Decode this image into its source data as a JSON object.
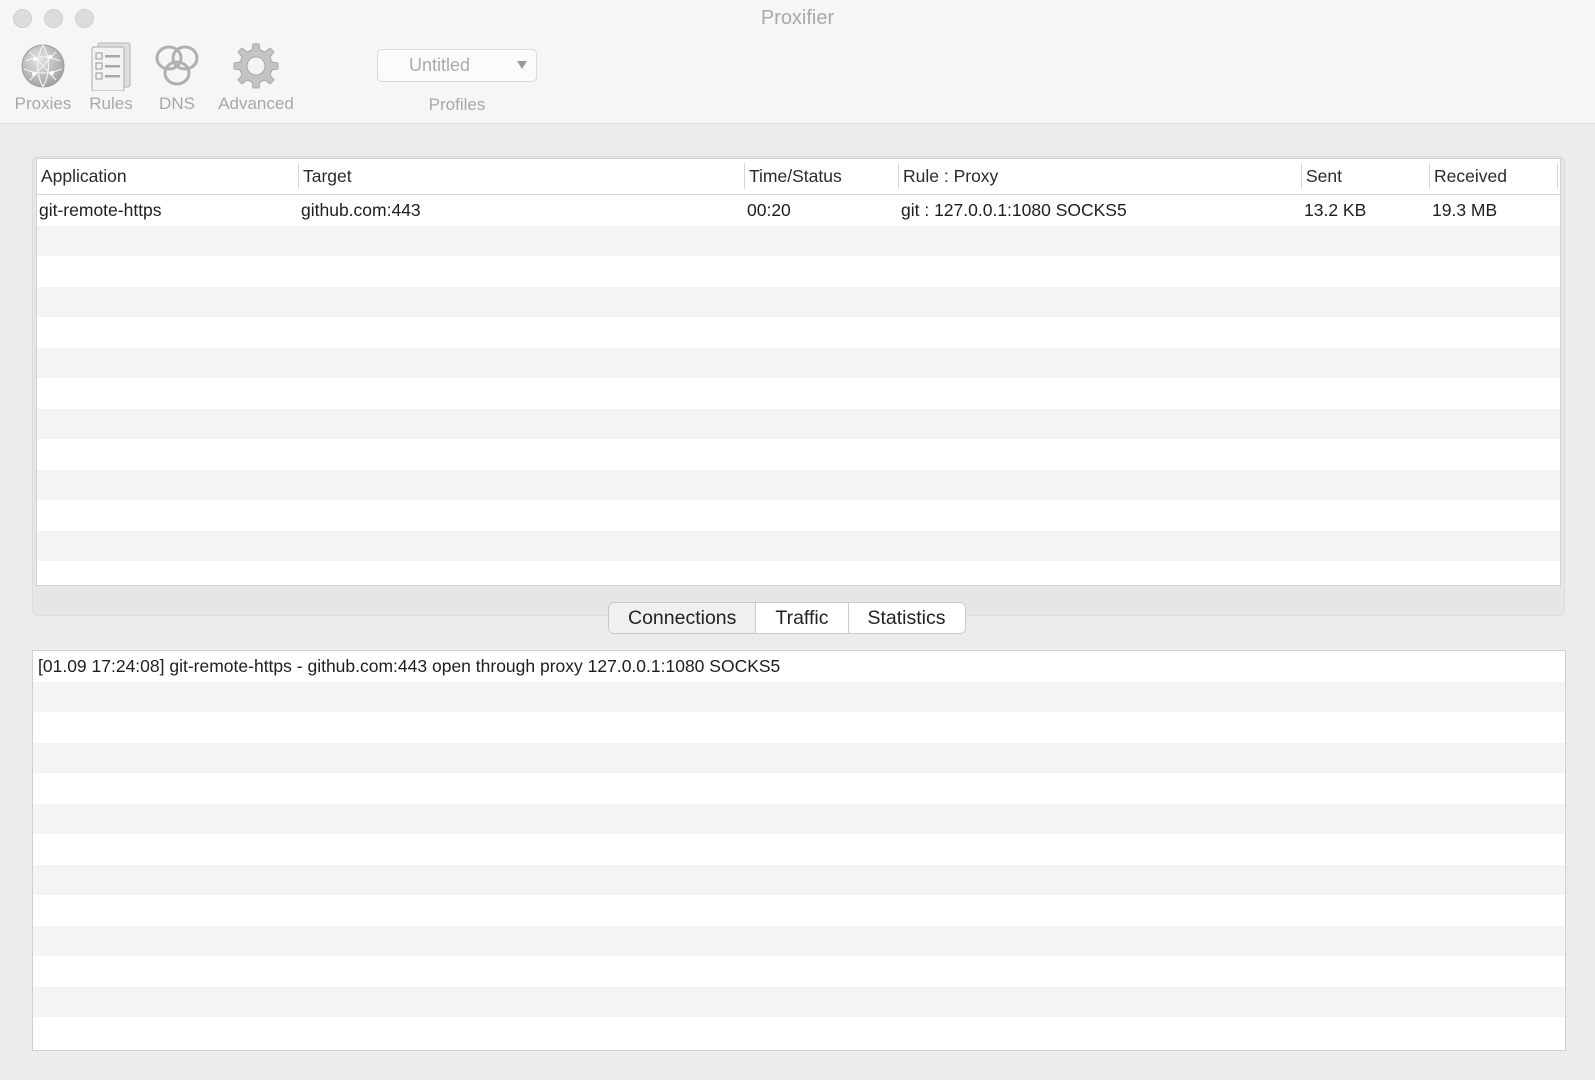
{
  "window": {
    "title": "Proxifier"
  },
  "toolbar": {
    "items": [
      {
        "label": "Proxies",
        "icon": "globe-icon"
      },
      {
        "label": "Rules",
        "icon": "rules-list-icon"
      },
      {
        "label": "DNS",
        "icon": "dns-rings-icon"
      },
      {
        "label": "Advanced",
        "icon": "gear-icon"
      }
    ],
    "profiles": {
      "selected": "Untitled",
      "label": "Profiles"
    }
  },
  "connections": {
    "columns": [
      "Application",
      "Target",
      "Time/Status",
      "Rule : Proxy",
      "Sent",
      "Received"
    ],
    "rows": [
      [
        "git-remote-https",
        "github.com:443",
        "00:20",
        "git : 127.0.0.1:1080 SOCKS5",
        "13.2 KB",
        "19.3 MB"
      ]
    ]
  },
  "tabs": [
    {
      "label": "Connections",
      "active": true
    },
    {
      "label": "Traffic",
      "active": false
    },
    {
      "label": "Statistics",
      "active": false
    }
  ],
  "log": {
    "lines": [
      "[01.09 17:24:08] git-remote-https - github.com:443 open through proxy 127.0.0.1:1080 SOCKS5"
    ]
  },
  "colors": {
    "window_bg": "#ececec",
    "toolbar_bg": "#f6f6f6",
    "disabled_text": "#a8a8a8",
    "row_stripe": "#f4f4f4"
  }
}
